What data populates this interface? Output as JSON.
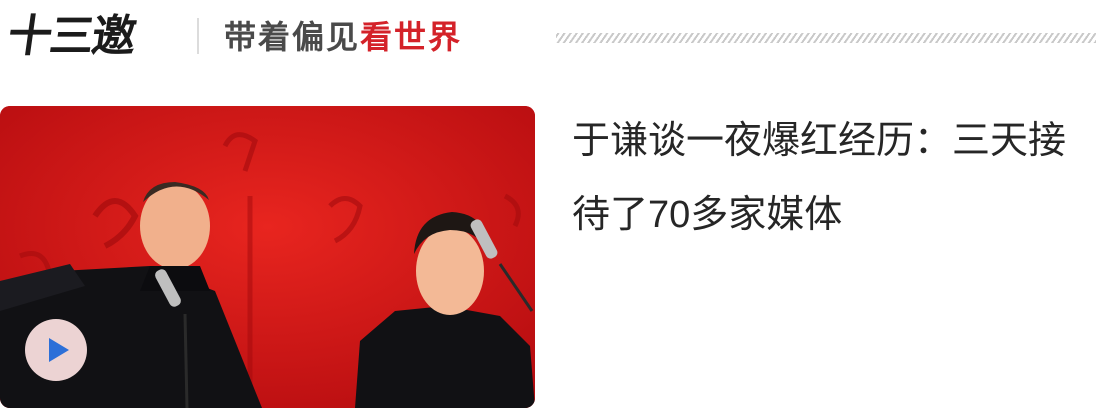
{
  "header": {
    "logo_text": "十三邀",
    "slogan_dark": "带着偏见",
    "slogan_red": "看世界"
  },
  "article": {
    "title": "于谦谈一夜爆红经历：三天接待了70多家媒体",
    "thumbnail_alt": "",
    "play_icon": "play-icon"
  },
  "colors": {
    "accent_red": "#d42229",
    "play_blue": "#2c6fd8",
    "title_text": "#262626"
  }
}
